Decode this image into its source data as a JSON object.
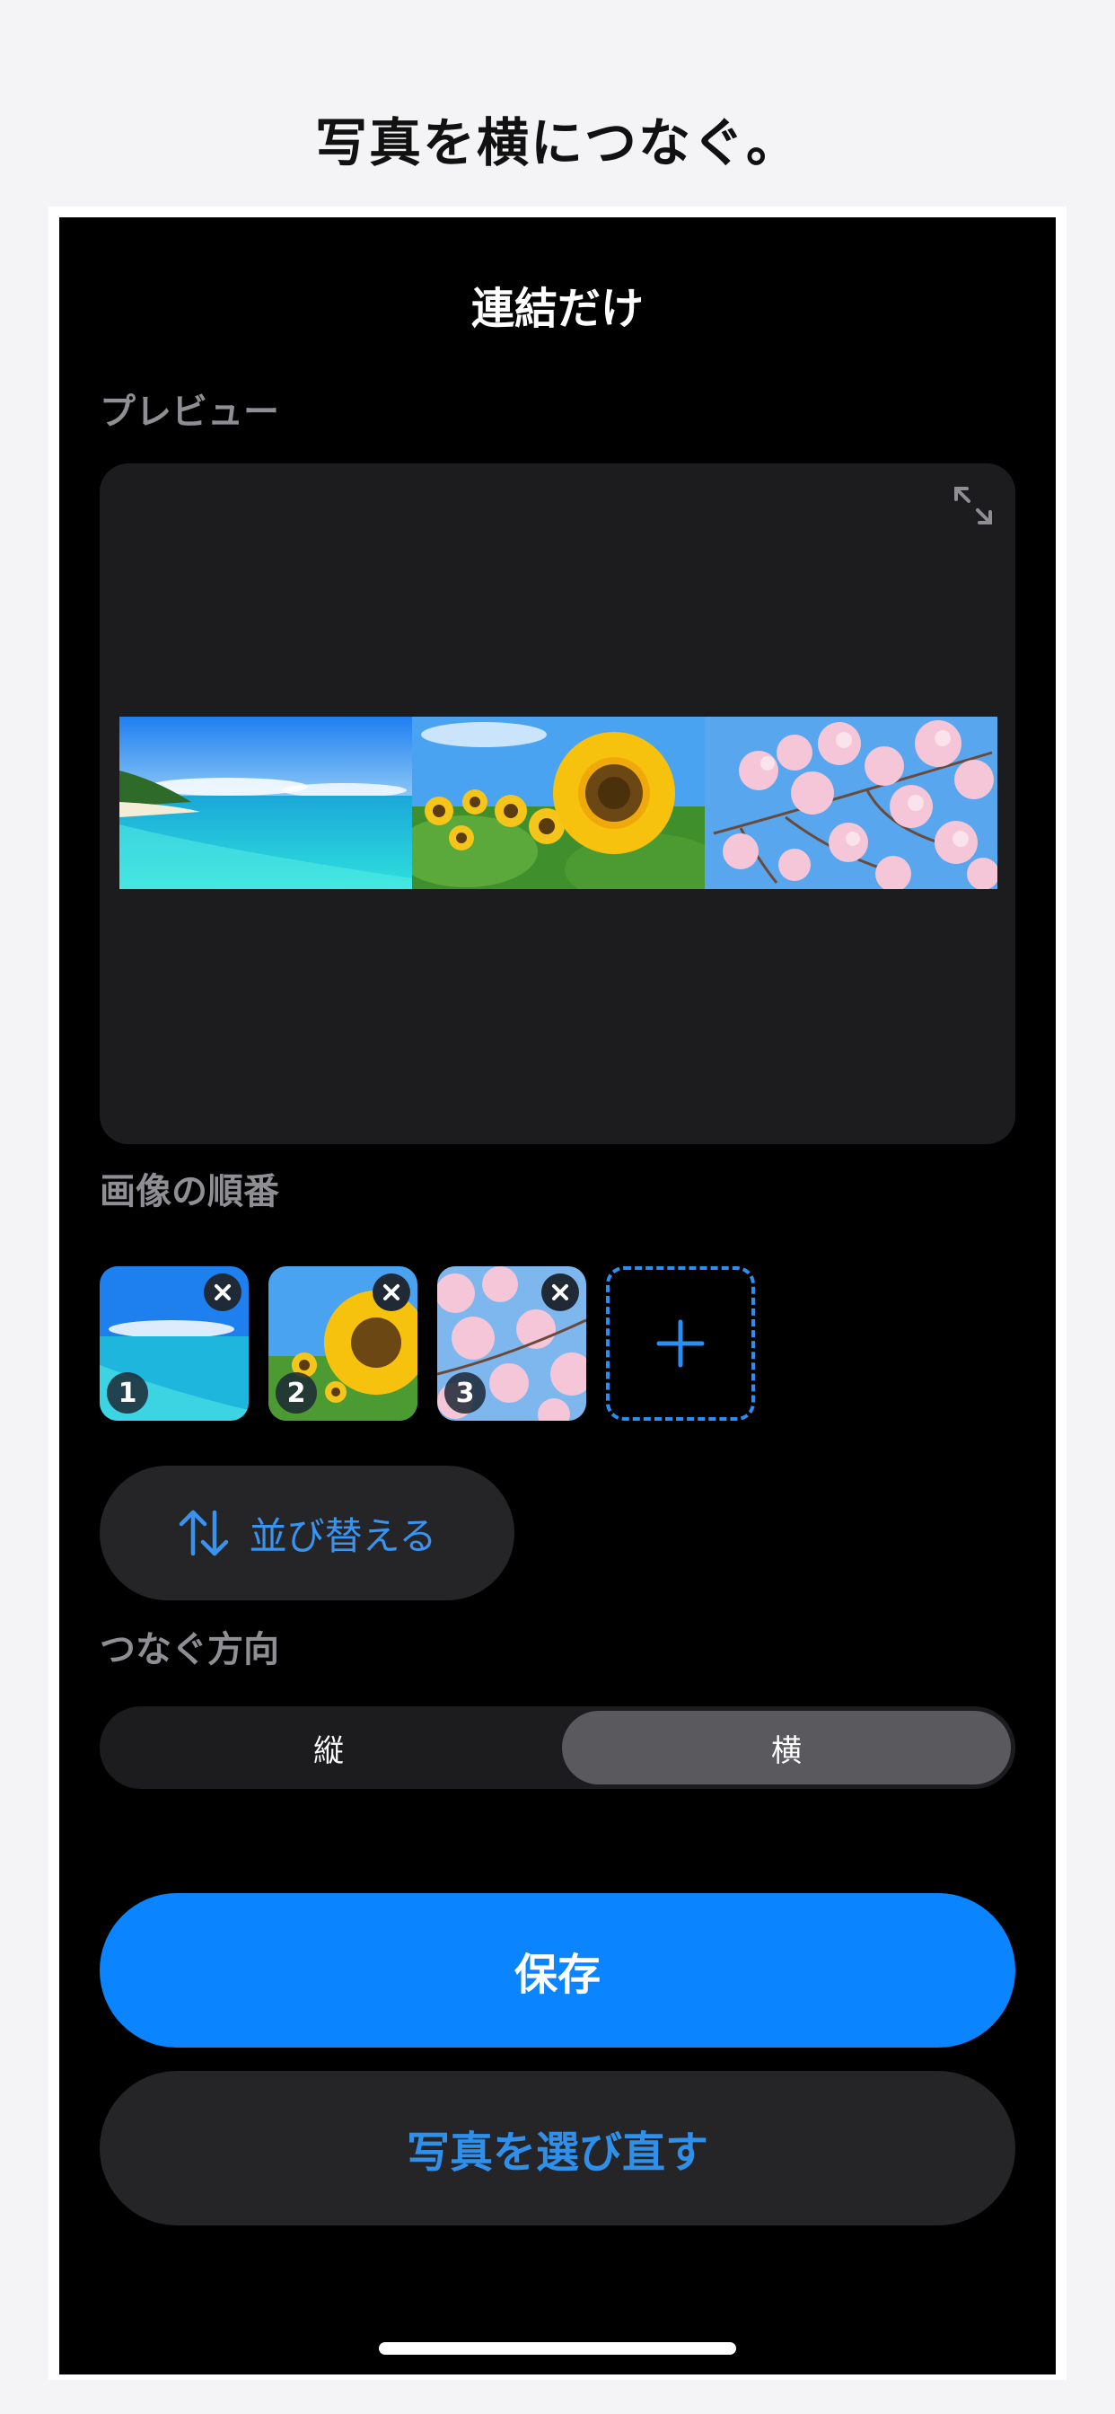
{
  "headline": "写真を横につなぐ。",
  "screen": {
    "title": "連結だけ",
    "preview_label": "プレビュー",
    "order_label": "画像の順番",
    "direction_label": "つなぐ方向",
    "reorder_button": "並び替える",
    "direction_options": [
      {
        "label": "縦",
        "selected": false
      },
      {
        "label": "横",
        "selected": true
      }
    ],
    "save_button": "保存",
    "reselect_button": "写真を選び直す"
  },
  "thumbnails": [
    {
      "number": "1",
      "subject": "beach"
    },
    {
      "number": "2",
      "subject": "sunflowers"
    },
    {
      "number": "3",
      "subject": "cherry-blossoms"
    }
  ],
  "icons": {
    "expand": "expand-icon",
    "remove": "close-icon",
    "add": "plus-icon",
    "reorder": "swap-vertical-icon"
  },
  "colors": {
    "accent": "#0a84ff",
    "accent_text": "#3a93ef",
    "screen_bg": "#000000",
    "card_bg": "#1c1c1e",
    "segment_selected": "#5a5a5e"
  }
}
